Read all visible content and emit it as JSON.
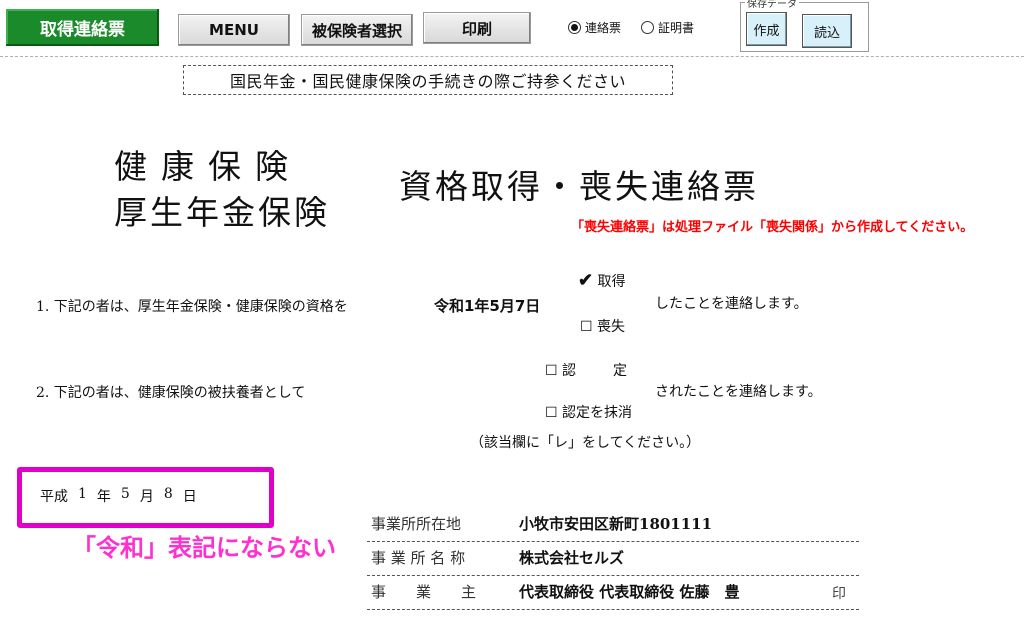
{
  "toolbar": {
    "primary_button": "取得連絡票",
    "menu_button": "MENU",
    "insured_select_button": "被保険者選択",
    "print_button": "印刷",
    "radio_options": [
      {
        "label": "連絡票",
        "selected": true
      },
      {
        "label": "証明書",
        "selected": false
      }
    ],
    "save_group_label": "保存データ",
    "create_button": "作成",
    "load_button": "読込"
  },
  "notice": "国民年金・国民健康保険の手続きの際ご持参ください",
  "title": {
    "left_line1": "健康保険",
    "left_line2": "厚生年金保険",
    "main": "資格取得・喪失連絡票"
  },
  "red_note": "「喪失連絡票」は処理ファイル「喪失関係」から作成してください。",
  "item1": {
    "text": "1. 下記の者は、厚生年金保険・健康保険の資格を",
    "date": "令和1年5月7日",
    "options": [
      {
        "label": "取得",
        "checked": true
      },
      {
        "label": "喪失",
        "checked": false
      }
    ],
    "suffix": "したことを連絡します。"
  },
  "item2": {
    "text": "2. 下記の者は、健康保険の被扶養者として",
    "options": [
      {
        "label": "認　　定",
        "checked": false
      },
      {
        "label": "認定を抹消",
        "checked": false
      }
    ],
    "suffix": "されたことを連絡します。"
  },
  "instruction": "（該当欄に「レ」をしてください。）",
  "date_box": {
    "era": "平成",
    "year": "1",
    "year_unit": "年",
    "month": "5",
    "month_unit": "月",
    "day": "8",
    "day_unit": "日"
  },
  "annotation": "「令和」表記にならない",
  "employer": [
    {
      "label": "事業所所在地",
      "value": "小牧市安田区新町1801111"
    },
    {
      "label": "事 業 所 名 称",
      "value": "株式会社セルズ"
    },
    {
      "label": "事　　業　　主",
      "value": "代表取締役 代表取締役  佐藤　豊"
    }
  ],
  "seal_mark": "印",
  "colors": {
    "primary_button": "#1a8a2a",
    "red_note": "#ff0000",
    "highlight": "#e000c8",
    "blue_button": "#d8f0fa"
  }
}
